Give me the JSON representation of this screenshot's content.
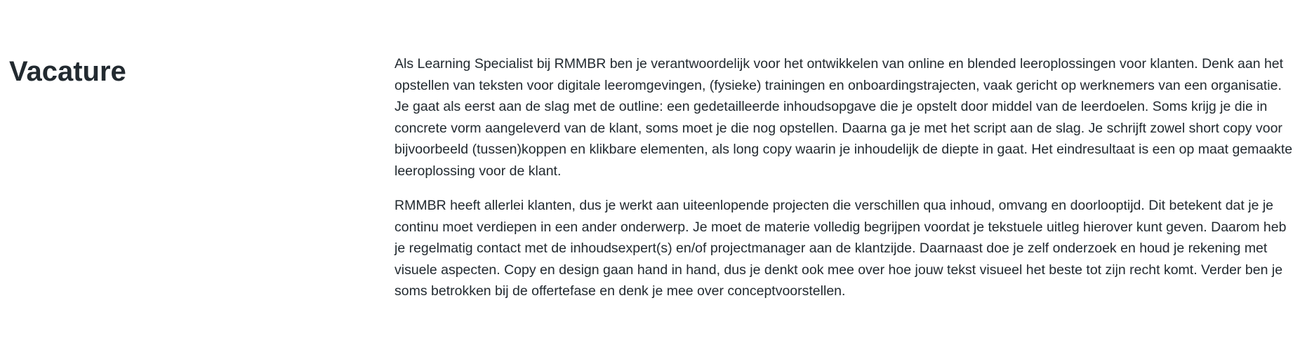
{
  "section": {
    "heading": "Vacature",
    "paragraphs": [
      "Als Learning Specialist bij RMMBR ben je verantwoordelijk voor het ontwikkelen van online en blended leeroplossingen voor klanten. Denk aan het opstellen van teksten voor digitale leeromgevingen, (fysieke) trainingen en onboardingstrajecten, vaak gericht op werknemers van een organisatie. Je gaat als eerst aan de slag met de outline: een gedetailleerde inhoudsopgave die je opstelt door middel van de leerdoelen. Soms krijg je die in concrete vorm aangeleverd van de klant, soms moet je die nog opstellen. Daarna ga je met het script aan de slag. Je schrijft zowel short copy voor bijvoorbeeld (tussen)koppen en klikbare elementen, als long copy waarin je inhoudelijk de diepte in gaat. Het eindresultaat is een op maat gemaakte leeroplossing voor de klant.",
      "RMMBR heeft allerlei klanten, dus je werkt aan uiteenlopende projecten die verschillen qua inhoud, omvang en doorlooptijd. Dit betekent dat je je continu moet verdiepen in een ander onderwerp. Je moet de materie volledig begrijpen voordat je tekstuele uitleg hierover kunt geven. Daarom heb je regelmatig contact met de inhoudsexpert(s) en/of projectmanager aan de klantzijde. Daarnaast doe je zelf onderzoek en houd je rekening met visuele aspecten. Copy en design gaan hand in hand, dus je denkt ook mee over hoe jouw tekst visueel het beste tot zijn recht komt. Verder ben je soms betrokken bij de offertefase en denk je mee over conceptvoorstellen."
    ]
  },
  "colors": {
    "text": "#222a30",
    "background": "#ffffff"
  }
}
